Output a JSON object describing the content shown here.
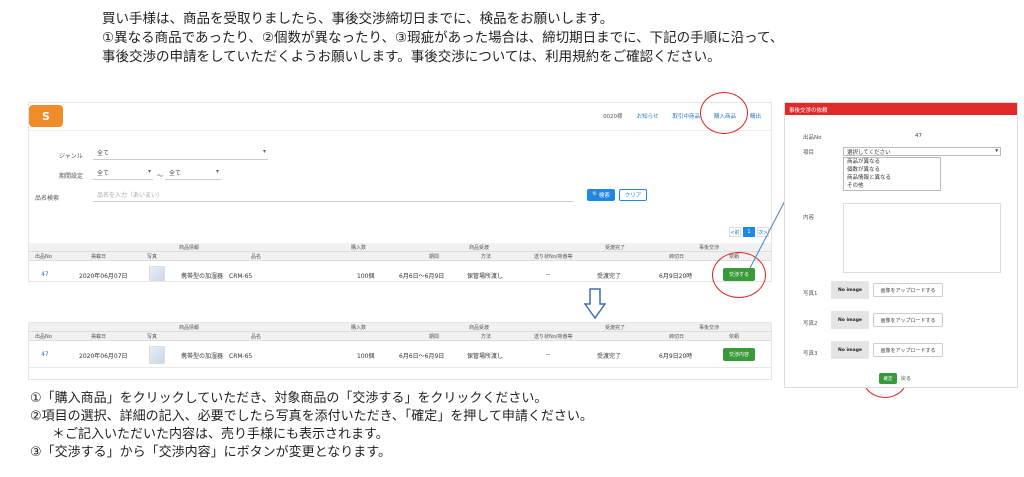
{
  "intro": {
    "line1": "買い手様は、商品を受取りましたら、事後交渉締切日までに、検品をお願いします。",
    "line2": "①異なる商品であったり、②個数が異なったり、③瑕疵があった場合は、締切期日までに、下記の手順に沿って、",
    "line3": "事後交渉の申請をしていただくようお願いします。事後交渉については、利用規約をご確認ください。"
  },
  "app": {
    "logo": "S",
    "nav": [
      "0020様",
      "お知らせ",
      "取引中商品",
      "購入商品",
      "購出"
    ],
    "filters": {
      "genre_label": "ジャンル",
      "genre_value": "全て",
      "period_label": "期間設定",
      "period_from": "全て",
      "period_sep": "〜",
      "period_to": "全て",
      "keyword_label": "品名検索",
      "keyword_placeholder": "品名を入力（あいまい）",
      "search_button": "検索",
      "clear_button": "クリア"
    },
    "pager": [
      "<前",
      "1",
      "次>"
    ],
    "table": {
      "group_headers": [
        "商品情報",
        "購入数",
        "商品受渡",
        "受渡完了",
        "事後交渉"
      ],
      "headers": [
        "出品No",
        "掲載日",
        "写真",
        "品名",
        "",
        "期間",
        "方法",
        "送り状No/荷番等",
        "",
        "締切日",
        "依頼"
      ],
      "row": {
        "no": "47",
        "date": "2020年06月07日",
        "name": "携帯型の加湿器　CRM-65",
        "qty": "100個",
        "period": "6月6日〜6月9日",
        "method": "保管場所渡し",
        "tracking": "--",
        "status": "受渡完了",
        "deadline": "6月9日20時"
      },
      "action_before": "交渉する",
      "action_after": "交渉内容"
    }
  },
  "modal": {
    "title": "事後交渉の依頼",
    "no_label": "出品No",
    "no_value": "47",
    "item_label": "項目",
    "item_selected": "選択してください",
    "item_options": [
      "商品が異なる",
      "個数が異なる",
      "商品情報と異なる",
      "その他"
    ],
    "content_label": "内容",
    "photos": [
      {
        "label": "写真1",
        "placeholder": "No image",
        "upload": "画像をアップロードする"
      },
      {
        "label": "写真2",
        "placeholder": "No image",
        "upload": "画像をアップロードする"
      },
      {
        "label": "写真3",
        "placeholder": "No image",
        "upload": "画像をアップロードする"
      }
    ],
    "confirm_button": "確定",
    "back_button": "戻る"
  },
  "steps": {
    "s1": "①「購入商品」をクリックしていただき、対象商品の「交渉する」をクリックください。",
    "s2": "②項目の選択、詳細の記入、必要でしたら写真を添付いただき、「確定」を押して申請ください。",
    "s2note": "＊ご記入いただいた内容は、売り手様にも表示されます。",
    "s3": "③「交渉する」から「交渉内容」にボタンが変更となります。"
  },
  "colors": {
    "accent": "#1e88e5",
    "green": "#3a9a3a",
    "red": "#e02a2a",
    "logo": "#f08c2a"
  }
}
